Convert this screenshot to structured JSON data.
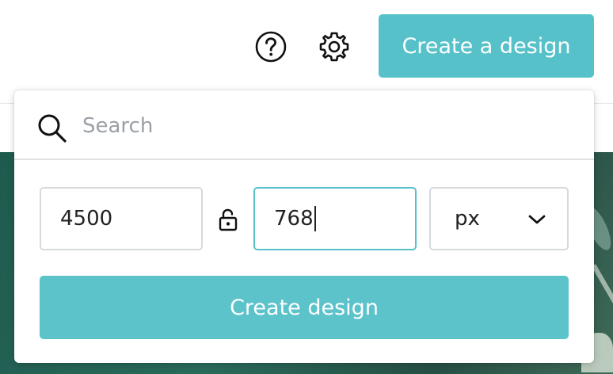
{
  "header": {
    "create_button_label": "Create a design",
    "help_icon": "help-circle-icon",
    "settings_icon": "gear-icon"
  },
  "dropdown": {
    "search": {
      "placeholder": "Search",
      "value": ""
    },
    "dimensions": {
      "width": "4500",
      "height": "768",
      "lock_icon": "unlocked-padlock-icon",
      "unit": "px"
    },
    "create_button_label": "Create design"
  },
  "colors": {
    "accent": "#56c1c9",
    "border": "#d6dadd",
    "focus_border": "#56c1c9",
    "hero_background": "#2a6b5c"
  }
}
